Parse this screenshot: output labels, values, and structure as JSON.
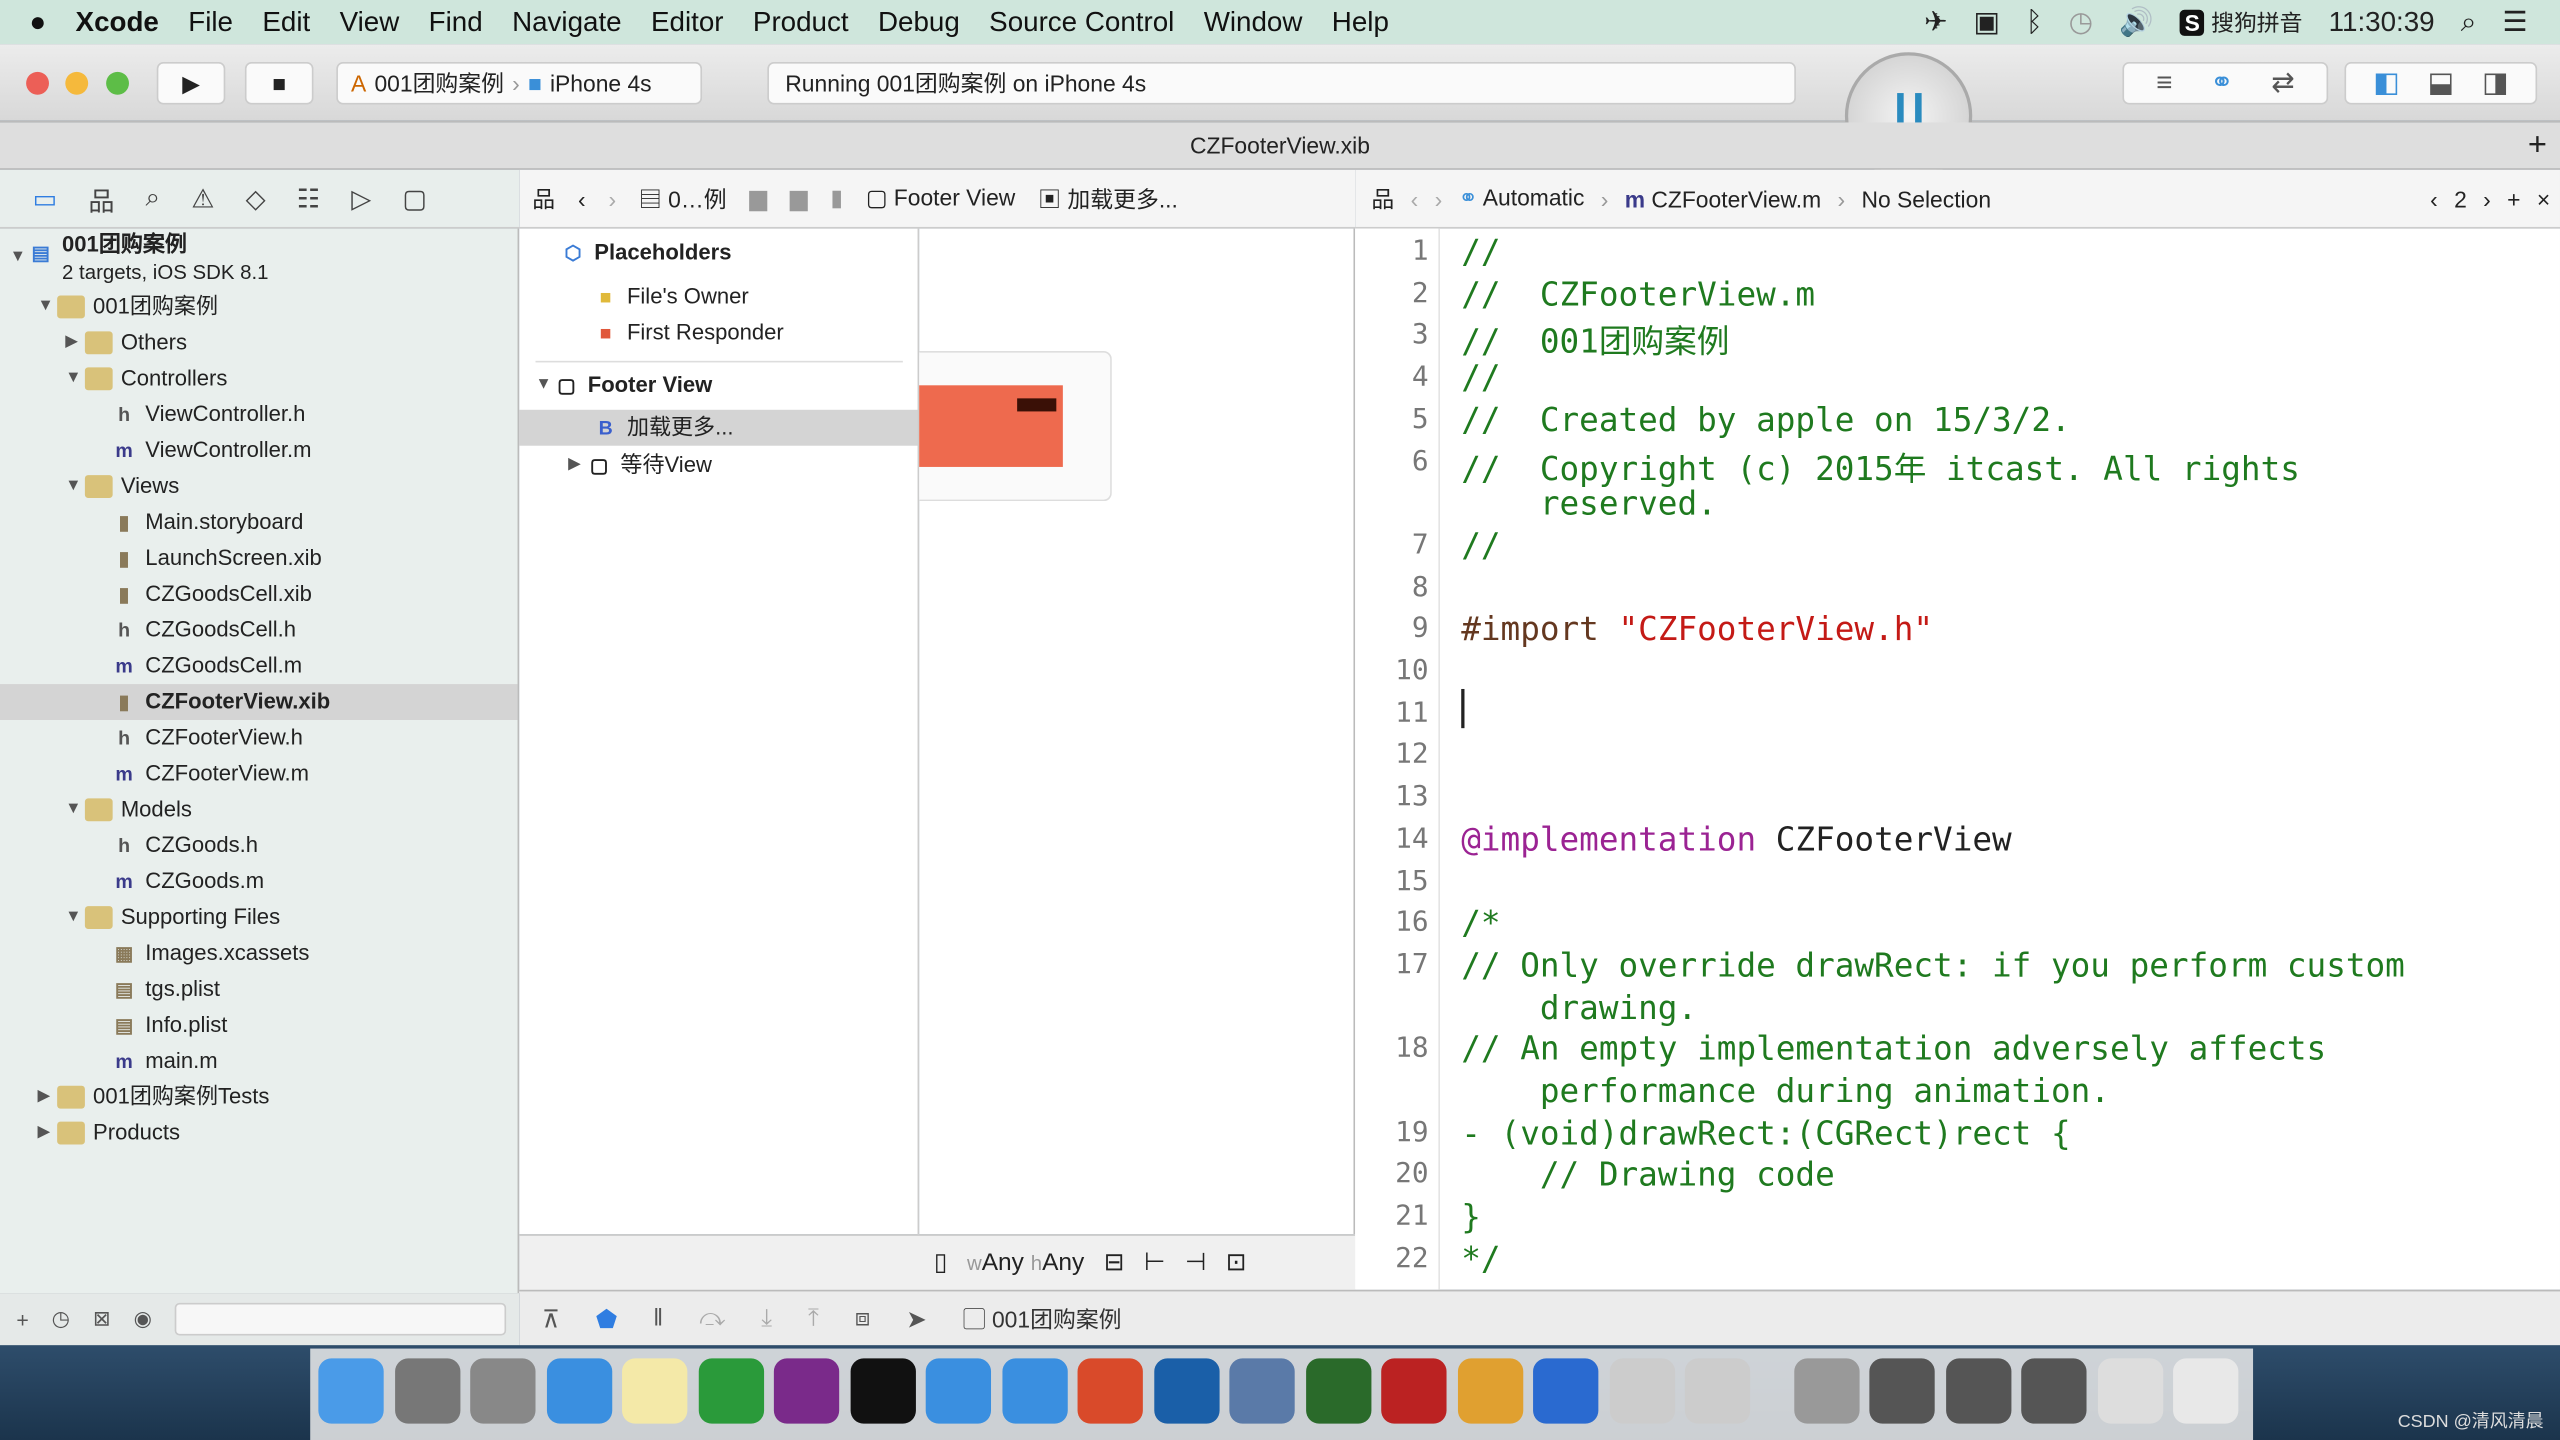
{
  "menubar": {
    "apple": "",
    "app": "Xcode",
    "items": [
      "File",
      "Edit",
      "View",
      "Find",
      "Navigate",
      "Editor",
      "Product",
      "Debug",
      "Source Control",
      "Window",
      "Help"
    ],
    "input_method": "搜狗拼音",
    "time": "11:30:39"
  },
  "toolbar": {
    "scheme": "001团购案例",
    "device": "iPhone 4s",
    "status": "Running 001团购案例 on iPhone 4s"
  },
  "tab": {
    "title": "CZFooterView.xib",
    "add": "+"
  },
  "navigator": {
    "project": {
      "name": "001团购案例",
      "subtitle": "2 targets, iOS SDK 8.1"
    },
    "items": [
      {
        "label": "001团购案例",
        "type": "folder",
        "depth": 1,
        "open": true
      },
      {
        "label": "Others",
        "type": "folder",
        "depth": 2,
        "open": false
      },
      {
        "label": "Controllers",
        "type": "folder",
        "depth": 2,
        "open": true
      },
      {
        "label": "ViewController.h",
        "type": "h",
        "depth": 3
      },
      {
        "label": "ViewController.m",
        "type": "m",
        "depth": 3
      },
      {
        "label": "Views",
        "type": "folder",
        "depth": 2,
        "open": true
      },
      {
        "label": "Main.storyboard",
        "type": "sb",
        "depth": 3
      },
      {
        "label": "LaunchScreen.xib",
        "type": "xib",
        "depth": 3
      },
      {
        "label": "CZGoodsCell.xib",
        "type": "xib",
        "depth": 3
      },
      {
        "label": "CZGoodsCell.h",
        "type": "h",
        "depth": 3
      },
      {
        "label": "CZGoodsCell.m",
        "type": "m",
        "depth": 3
      },
      {
        "label": "CZFooterView.xib",
        "type": "xib",
        "depth": 3,
        "selected": true
      },
      {
        "label": "CZFooterView.h",
        "type": "h",
        "depth": 3
      },
      {
        "label": "CZFooterView.m",
        "type": "m",
        "depth": 3
      },
      {
        "label": "Models",
        "type": "folder",
        "depth": 2,
        "open": true
      },
      {
        "label": "CZGoods.h",
        "type": "h",
        "depth": 3
      },
      {
        "label": "CZGoods.m",
        "type": "m",
        "depth": 3
      },
      {
        "label": "Supporting Files",
        "type": "folder",
        "depth": 2,
        "open": true
      },
      {
        "label": "Images.xcassets",
        "type": "assets",
        "depth": 3
      },
      {
        "label": "tgs.plist",
        "type": "plist",
        "depth": 3
      },
      {
        "label": "Info.plist",
        "type": "plist",
        "depth": 3
      },
      {
        "label": "main.m",
        "type": "m",
        "depth": 3
      },
      {
        "label": "001团购案例Tests",
        "type": "folder",
        "depth": 1,
        "open": false
      },
      {
        "label": "Products",
        "type": "folder",
        "depth": 1,
        "open": false
      }
    ]
  },
  "ib_jumpbar": {
    "crumbs": [
      "0…例",
      "Footer View",
      "加载更多..."
    ]
  },
  "outline": {
    "placeholders": "Placeholders",
    "files_owner": "File's Owner",
    "first_responder": "First Responder",
    "footer_view": "Footer View",
    "button": "加载更多...",
    "waiting_view": "等待View"
  },
  "ib_footer": {
    "w": "w",
    "w_any": "Any",
    "h": "h",
    "h_any": "Any"
  },
  "editor_jumpbar": {
    "mode": "Automatic",
    "file": "CZFooterView.m",
    "selection": "No Selection",
    "counter": "2"
  },
  "code": [
    {
      "n": "1",
      "t": "//"
    },
    {
      "n": "2",
      "t": "//  CZFooterView.m"
    },
    {
      "n": "3",
      "t": "//  001团购案例"
    },
    {
      "n": "4",
      "t": "//"
    },
    {
      "n": "5",
      "t": "//  Created by apple on 15/3/2."
    },
    {
      "n": "6",
      "t": "//  Copyright (c) 2015年 itcast. All rights"
    },
    {
      "n": "",
      "t": "    reserved."
    },
    {
      "n": "7",
      "t": "//"
    },
    {
      "n": "8",
      "t": ""
    },
    {
      "n": "9",
      "t": "#import ",
      "s": "\"CZFooterView.h\""
    },
    {
      "n": "10",
      "t": ""
    },
    {
      "n": "11",
      "t": ""
    },
    {
      "n": "12",
      "t": ""
    },
    {
      "n": "13",
      "t": ""
    },
    {
      "n": "14",
      "k": "@implementation",
      "p": " CZFooterView"
    },
    {
      "n": "15",
      "t": ""
    },
    {
      "n": "16",
      "t": "/*"
    },
    {
      "n": "17",
      "t": "// Only override drawRect: if you perform custom"
    },
    {
      "n": "",
      "t": "    drawing."
    },
    {
      "n": "18",
      "t": "// An empty implementation adversely affects"
    },
    {
      "n": "",
      "t": "    performance during animation."
    },
    {
      "n": "19",
      "t": "- (void)drawRect:(CGRect)rect {"
    },
    {
      "n": "20",
      "t": "    // Drawing code"
    },
    {
      "n": "21",
      "t": "}"
    },
    {
      "n": "22",
      "t": "*/"
    }
  ],
  "debug": {
    "target": "001团购案例"
  },
  "watermark": "CSDN @清风清晨",
  "colors": {
    "comment": "#1f7a1f",
    "keyword": "#9b2393",
    "string": "#c41a16",
    "preprocessor": "#643820",
    "menubar": "#cfe6dc"
  }
}
